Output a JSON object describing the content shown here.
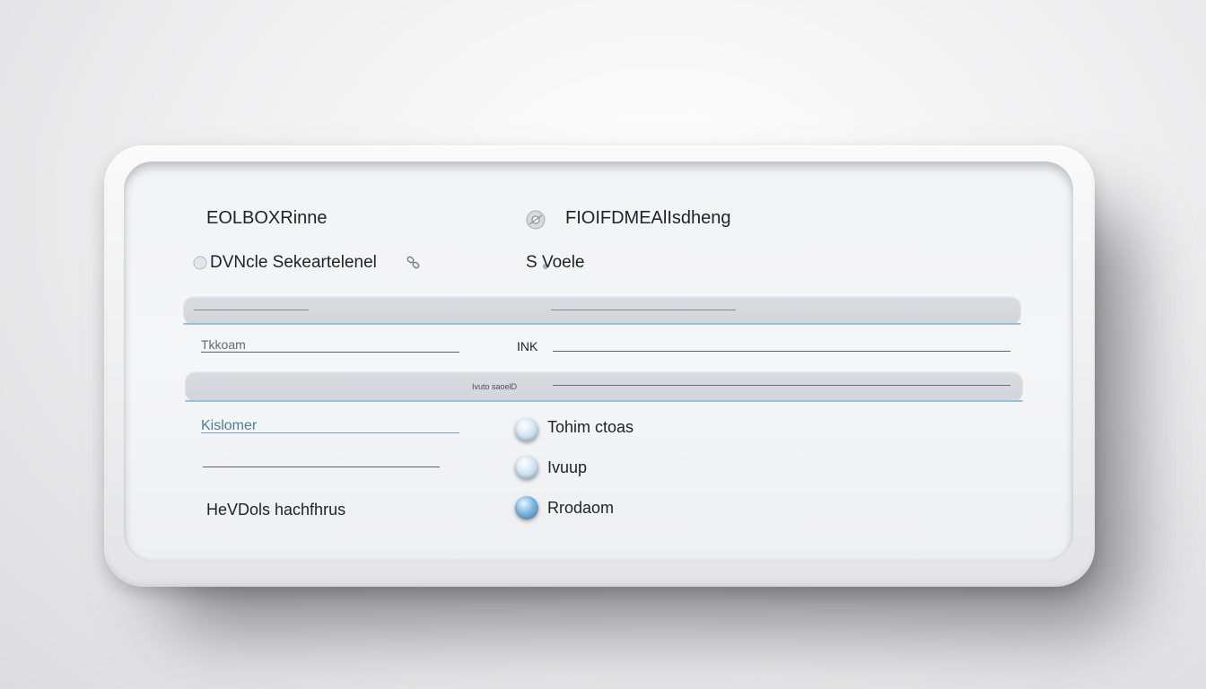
{
  "header": {
    "left_title": "EOLBOXRinne",
    "right_title": "FIOIFDMEAlIsdheng"
  },
  "row1": {
    "left_label": "DVNcle Sekeartelenel",
    "right_label": "S  Voele"
  },
  "fields": {
    "left_field_label": "Tkkoam",
    "right_field_label": "INK",
    "band2_label": "Ivuto saoelD",
    "left_field2_label": "Kislomer"
  },
  "options": {
    "left_item": "HeVDols hachfhrus",
    "radio_items": [
      {
        "label": "Tohim ctoas",
        "selected": false
      },
      {
        "label": "Ivuup",
        "selected": false
      },
      {
        "label": "Rrodaom",
        "selected": true
      }
    ]
  },
  "icons": {
    "settings": "gear-icon",
    "link": "link-icon",
    "dot": "dot-icon",
    "status": "status-icon"
  },
  "colors": {
    "accent": "#6aa9c8",
    "radio_selected": "#3d85bb"
  }
}
